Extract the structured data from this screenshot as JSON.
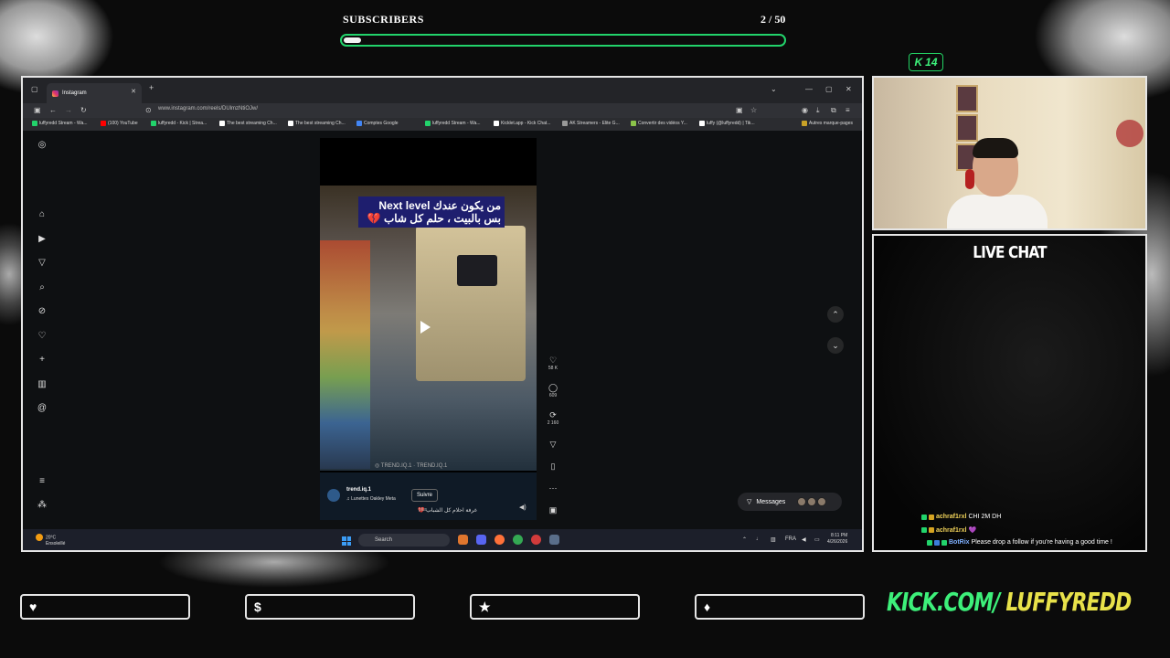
{
  "overlay": {
    "goal_title": "SUBSCRIBERS",
    "goal_count": "2 / 50",
    "goal_progress": 0.04,
    "kick_badge_count": "14",
    "chat_title": "LIVE CHAT",
    "kick_url_prefix": "KICK.COM/",
    "kick_url_name": "LUFFYREDD",
    "accent_color": "#22d36b",
    "bottom_boxes": [
      {
        "icon": "♥",
        "icon_name": "heart-icon"
      },
      {
        "icon": "$",
        "icon_name": "dollar-icon"
      },
      {
        "icon": "★",
        "icon_name": "star-icon"
      },
      {
        "icon": "♦",
        "icon_name": "diamond-icon"
      }
    ]
  },
  "browser": {
    "tab_title": "Instagram",
    "url": "www.instagram.com/reels/DUlmzNtiOJw/",
    "bookmarks": [
      "luffyredd Stream - Wa...",
      "(100) YouTube",
      "luffyredd - Kick | Strea...",
      "The best streaming Ch...",
      "The best streaming Ch...",
      "Comptes Google",
      "luffyredd Stream - Wa...",
      "Kicklet.app - Kick Chat...",
      "AK Streamers - Elite G...",
      "Convertir des vidéos Y...",
      "luffy (@luffyredd) | Tik...",
      "Autres marque-pages"
    ]
  },
  "reel": {
    "caption_line1_en": "Next level",
    "caption_line1_ar": "من يكون عندك",
    "caption_line2": "بس بالبيت ، حلم كل شاب 💔",
    "watermark": "◎ TREND.IQ.1 · TREND.IQ.1",
    "username": "trend.iq.1",
    "song": "♫ Lunettes Oakley Meta",
    "follow_label": "Suivre",
    "caption_text": "غرفة احلام كل الشباب 💔",
    "more_label": "plus ...",
    "likes": "58 K",
    "comments": "609",
    "shares": "2 160"
  },
  "messages_label": "Messages",
  "taskbar": {
    "weather_temp": "20°C",
    "weather_desc": "Ensoleillé",
    "search_placeholder": "Search",
    "lang": "FRA",
    "time": "8:11 PM",
    "date": "4/26/2026"
  },
  "chat": [
    {
      "user": "achraf1rxl",
      "text": "CHI 2M DH"
    },
    {
      "user": "achraf1rxl",
      "text": "💜"
    },
    {
      "user": "BotRix",
      "text": "Please drop a follow if you're having a good time !"
    }
  ]
}
